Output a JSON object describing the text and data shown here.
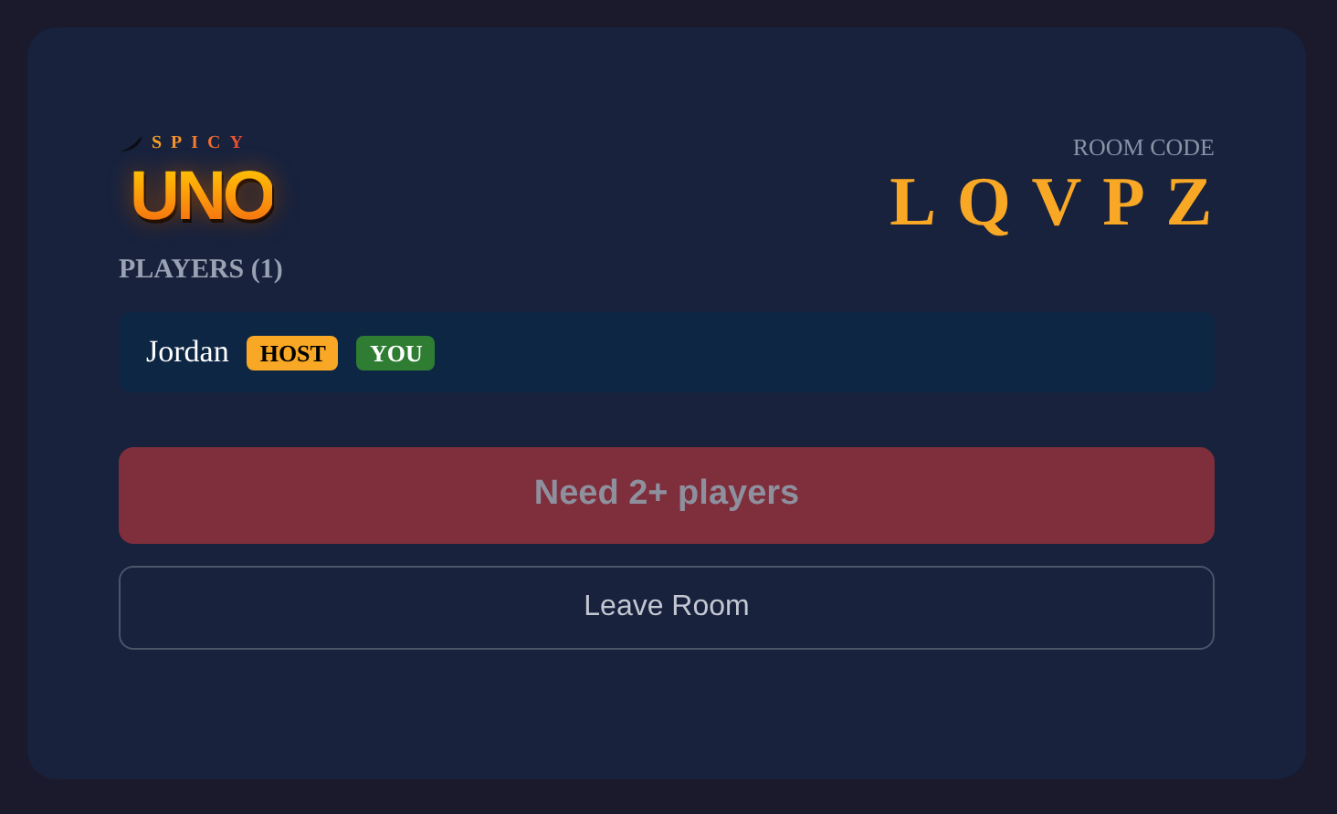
{
  "logo": {
    "tagline": "SPICY",
    "title": "UNO"
  },
  "room": {
    "label": "ROOM CODE",
    "code": "LQVPZ"
  },
  "players_heading": "PLAYERS (1)",
  "players": [
    {
      "name": "Jordan",
      "badges": [
        {
          "label": "HOST",
          "color": "#f9a825"
        },
        {
          "label": "YOU",
          "color": "#2e7d32"
        }
      ]
    }
  ],
  "start_button": {
    "label": "Need 2+ players",
    "disabled": true
  },
  "leave_button": {
    "label": "Leave Room"
  }
}
